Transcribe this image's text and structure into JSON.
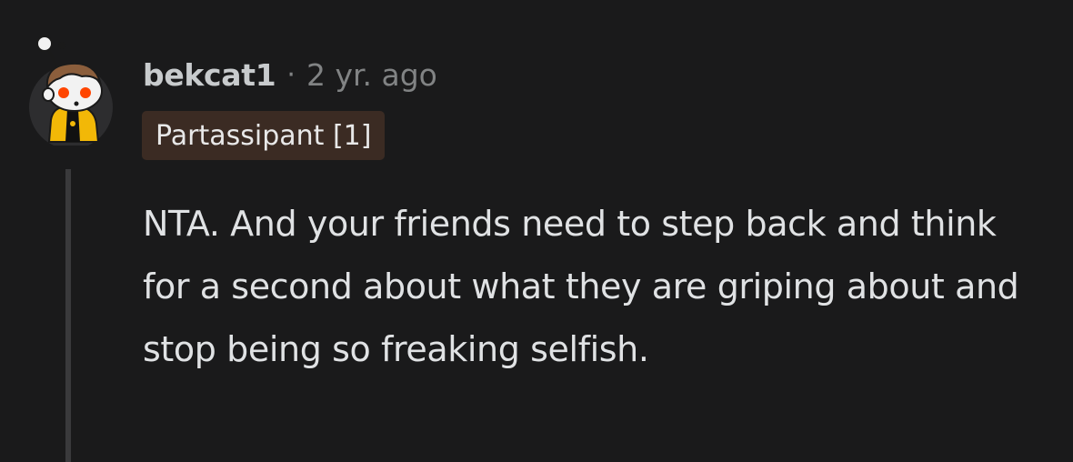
{
  "comment": {
    "username": "bekcat1",
    "separator": "·",
    "timestamp": "2 yr. ago",
    "flair": "Partassipant [1]",
    "body": "NTA. And your friends need to step back and think for a second about what they are griping about and stop being so freaking selfish.",
    "avatar_icon": "snoo-avatar-icon"
  },
  "colors": {
    "background": "#1a1a1b",
    "username": "#c8cbcd",
    "meta": "#818384",
    "flair_bg": "#3b2b23",
    "body": "#e0e2e4",
    "thread_line": "#3a3a3c"
  }
}
